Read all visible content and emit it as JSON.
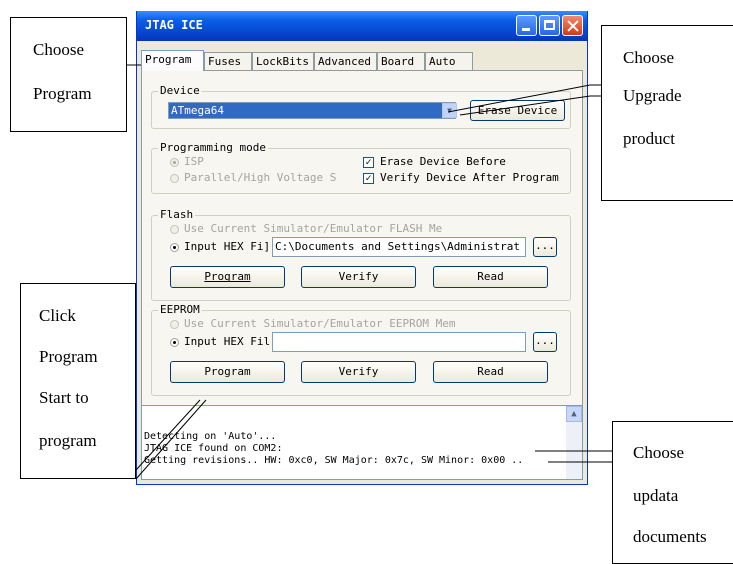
{
  "window": {
    "title": "JTAG ICE",
    "tabs": [
      "Program",
      "Fuses",
      "LockBits",
      "Advanced",
      "Board",
      "Auto"
    ],
    "active_tab": "Program"
  },
  "device": {
    "legend": "Device",
    "selected": "ATmega64",
    "erase_button": "Erase Device"
  },
  "programming_mode": {
    "legend": "Programming mode",
    "isp": "ISP",
    "parallel": "Parallel/High Voltage S",
    "erase_before": "Erase Device Before",
    "verify_after": "Verify Device After Program"
  },
  "flash": {
    "legend": "Flash",
    "use_sim": "Use Current Simulator/Emulator FLASH Me",
    "input_hex": "Input HEX Fi]",
    "path": "C:\\Documents and Settings\\Administrat",
    "browse": "...",
    "program": "Program",
    "verify": "Verify",
    "read": "Read"
  },
  "eeprom": {
    "legend": "EEPROM",
    "use_sim": "Use Current Simulator/Emulator EEPROM Mem",
    "input_hex": "Input HEX Fil",
    "path": "",
    "browse": "...",
    "program": "Program",
    "verify": "Verify",
    "read": "Read"
  },
  "log": [
    "Detecting on 'Auto'...",
    "JTAG ICE found on COM2:",
    "Getting revisions.. HW: 0xc0, SW Major: 0x7c, SW Minor: 0x00 .."
  ],
  "callouts": {
    "choose_program": [
      "Choose",
      "Program"
    ],
    "choose_upgrade": [
      "Choose",
      "Upgrade",
      "product"
    ],
    "click_program": [
      "Click",
      "Program",
      "Start to",
      "program"
    ],
    "choose_updata": [
      "Choose",
      "updata",
      "documents"
    ]
  }
}
